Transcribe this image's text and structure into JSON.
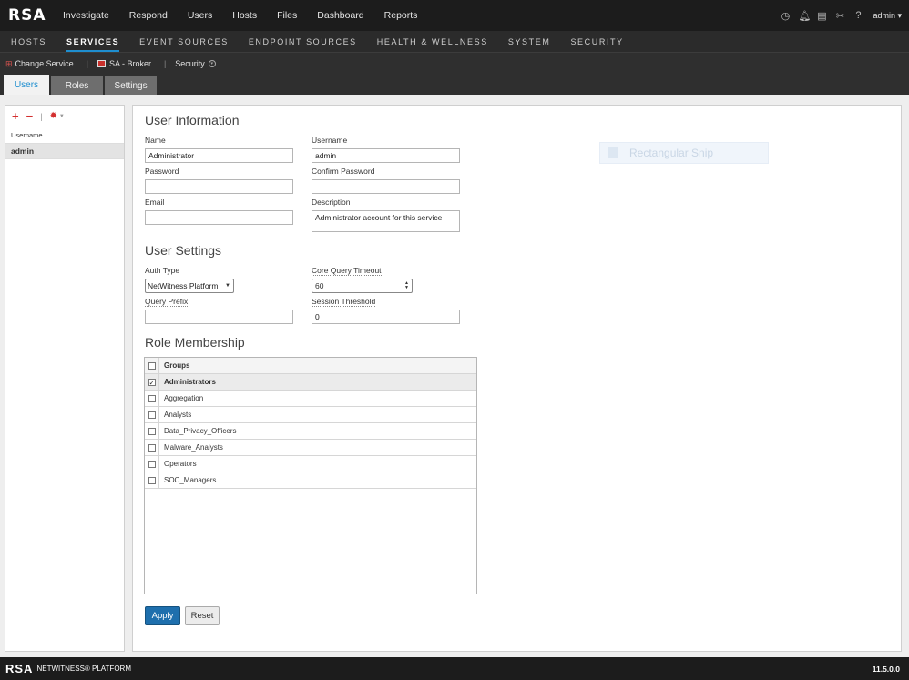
{
  "brand": {
    "logo": "RSA"
  },
  "topnav": {
    "items": [
      "Investigate",
      "Respond",
      "Users",
      "Hosts",
      "Files",
      "Dashboard",
      "Reports"
    ],
    "user": "admin"
  },
  "secnav": {
    "items": [
      "HOSTS",
      "SERVICES",
      "EVENT SOURCES",
      "ENDPOINT SOURCES",
      "HEALTH & WELLNESS",
      "SYSTEM",
      "SECURITY"
    ],
    "active": "SERVICES"
  },
  "service_bar": {
    "change_service": "Change Service",
    "service": "SA - Broker",
    "section": "Security"
  },
  "tabs": [
    "Users",
    "Roles",
    "Settings"
  ],
  "left_panel": {
    "column_header": "Username",
    "rows": [
      "admin"
    ]
  },
  "user_information": {
    "heading": "User Information",
    "name_label": "Name",
    "name_value": "Administrator",
    "username_label": "Username",
    "username_value": "admin",
    "password_label": "Password",
    "confirm_password_label": "Confirm Password",
    "email_label": "Email",
    "description_label": "Description",
    "description_value": "Administrator account for this service"
  },
  "ghost_overlay": {
    "text": "Rectangular Snip"
  },
  "user_settings": {
    "heading": "User Settings",
    "auth_type_label": "Auth Type",
    "auth_type_value": "NetWitness Platform",
    "core_query_timeout_label": "Core Query Timeout",
    "core_query_timeout_value": "60",
    "query_prefix_label": "Query Prefix",
    "session_threshold_label": "Session Threshold",
    "session_threshold_value": "0"
  },
  "role_membership": {
    "heading": "Role Membership",
    "column_header": "Groups",
    "groups": [
      {
        "name": "Administrators",
        "checked": true
      },
      {
        "name": "Aggregation",
        "checked": false
      },
      {
        "name": "Analysts",
        "checked": false
      },
      {
        "name": "Data_Privacy_Officers",
        "checked": false
      },
      {
        "name": "Malware_Analysts",
        "checked": false
      },
      {
        "name": "Operators",
        "checked": false
      },
      {
        "name": "SOC_Managers",
        "checked": false
      }
    ]
  },
  "actions": {
    "apply": "Apply",
    "reset": "Reset"
  },
  "footer": {
    "logo": "RSA",
    "product": "NETWITNESS® PLATFORM",
    "version": "11.5.0.0"
  },
  "colors": {
    "accent": "#1e8ecf",
    "apply_button": "#1e6fad",
    "toolbar_red": "#d32f2f"
  }
}
